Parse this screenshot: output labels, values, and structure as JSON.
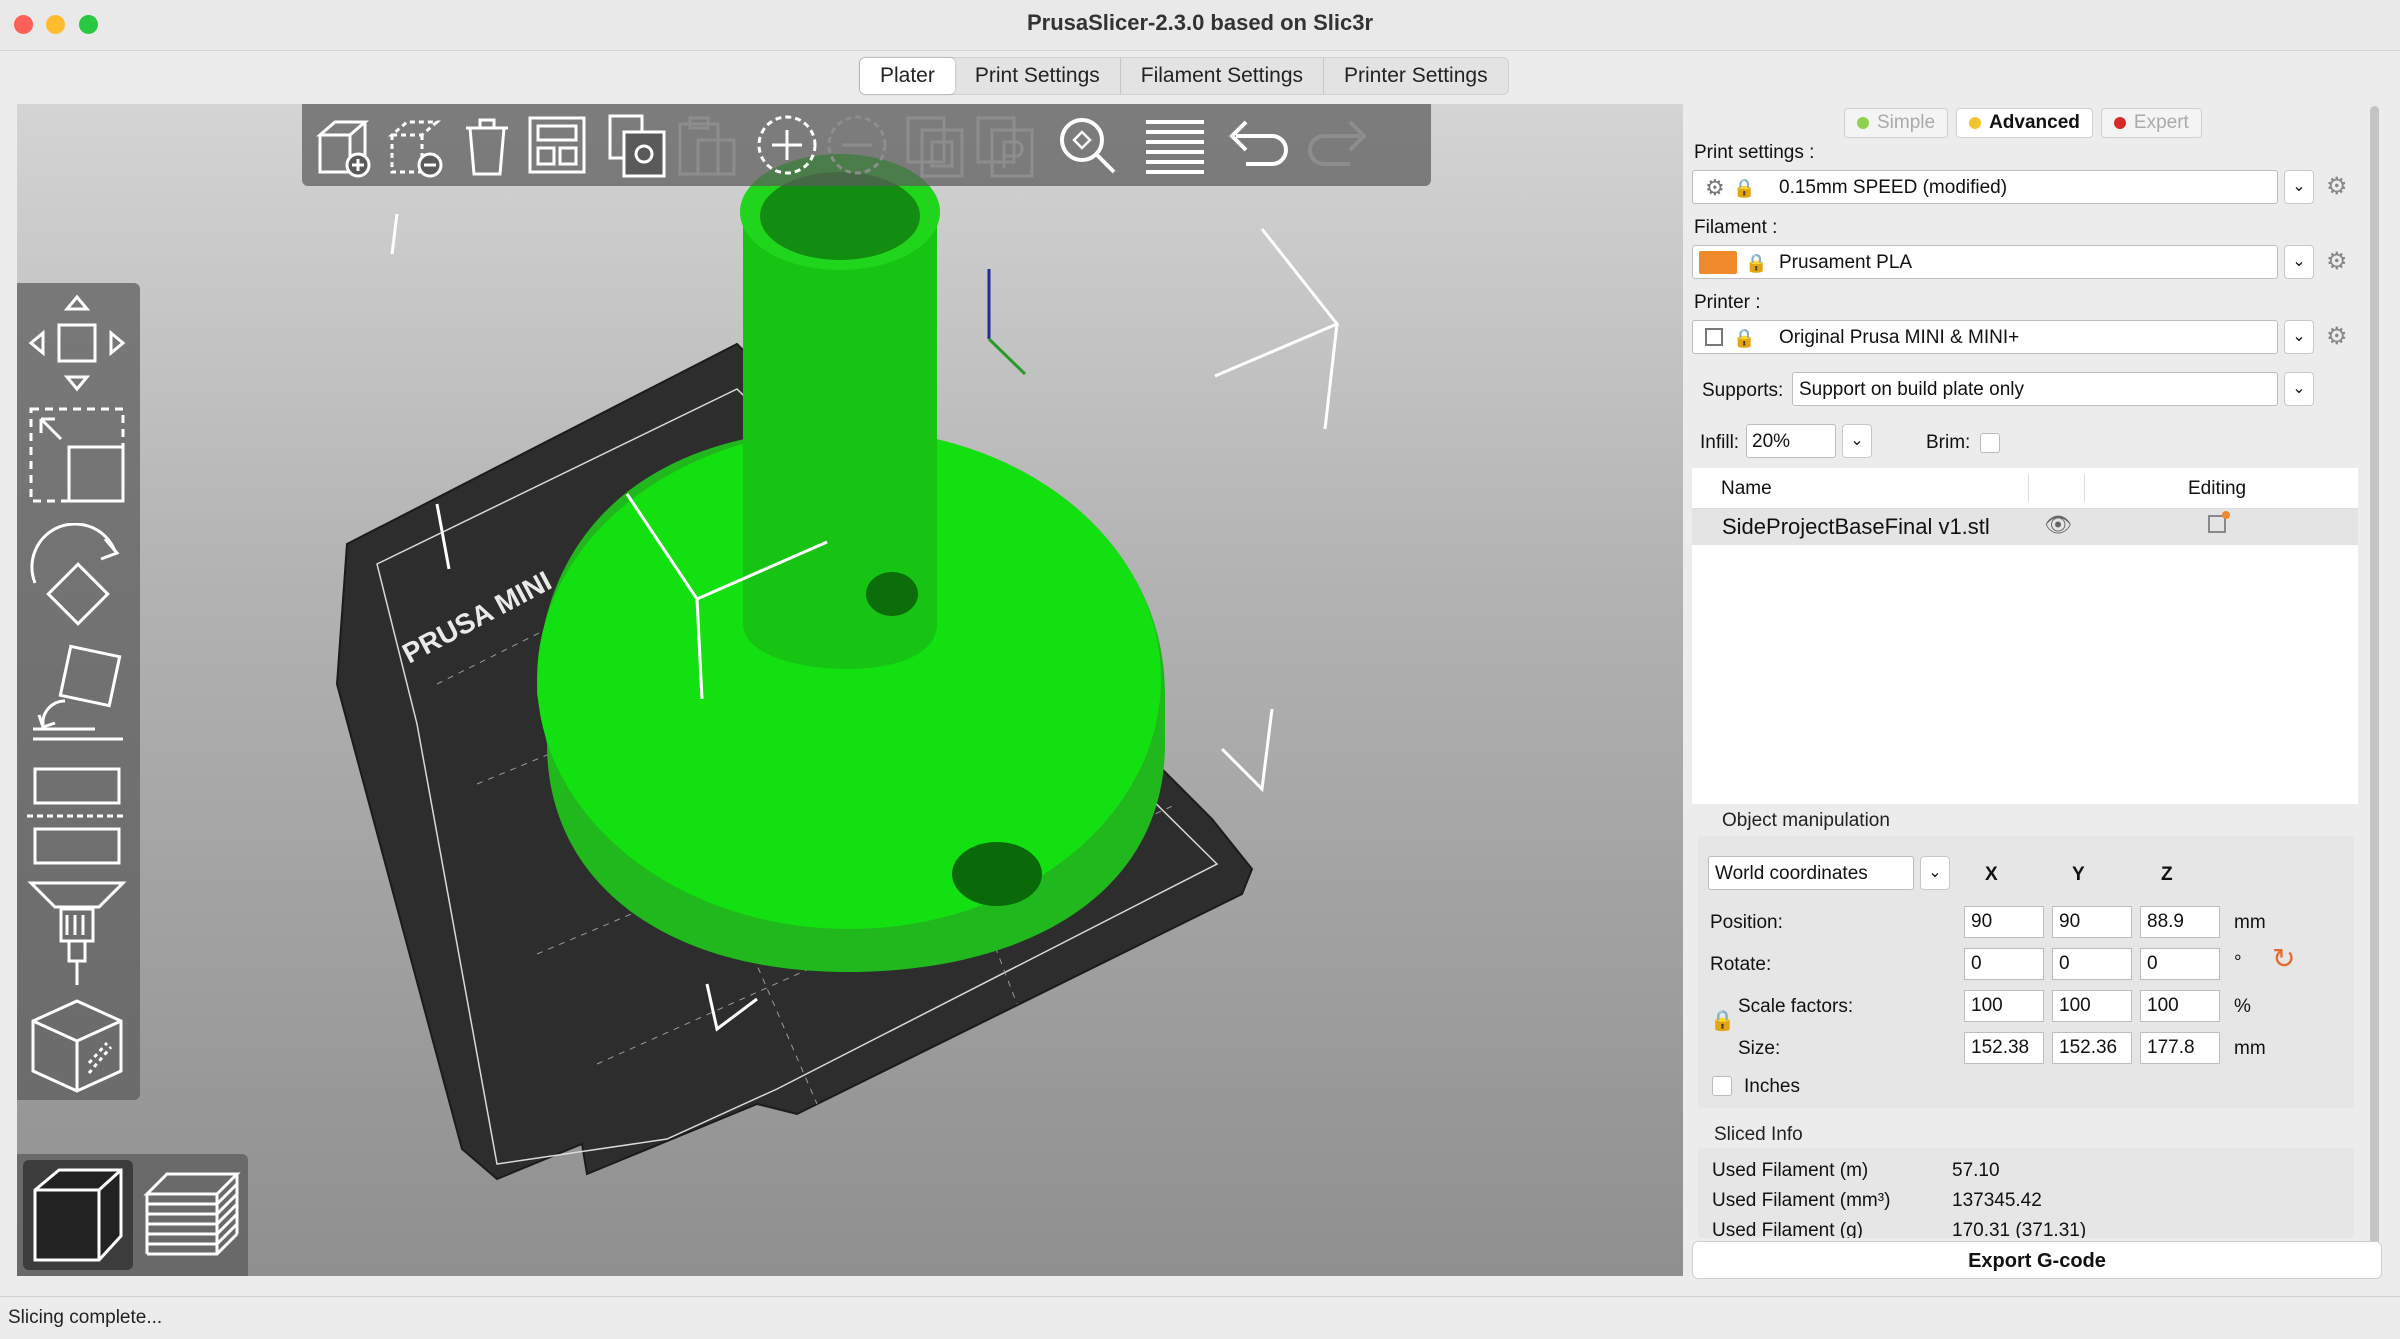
{
  "window": {
    "title": "PrusaSlicer-2.3.0 based on Slic3r"
  },
  "tabs": [
    {
      "label": "Plater"
    },
    {
      "label": "Print Settings"
    },
    {
      "label": "Filament Settings"
    },
    {
      "label": "Printer Settings"
    }
  ],
  "modes": {
    "simple": "Simple",
    "advanced": "Advanced",
    "expert": "Expert",
    "simple_color": "#8fd14f",
    "advanced_color": "#f4c430",
    "expert_color": "#d42a2a"
  },
  "print_settings": {
    "label": "Print settings :",
    "value": "0.15mm SPEED (modified)"
  },
  "filament": {
    "label": "Filament :",
    "value": "Prusament PLA",
    "color": "#f08a2a"
  },
  "printer": {
    "label": "Printer :",
    "value": "Original Prusa MINI & MINI+"
  },
  "supports": {
    "label": "Supports:",
    "value": "Support on build plate only"
  },
  "infill": {
    "label": "Infill:",
    "value": "20%"
  },
  "brim": {
    "label": "Brim:"
  },
  "object_list": {
    "col_name": "Name",
    "col_editing": "Editing",
    "items": [
      {
        "name": "SideProjectBaseFinal v1.stl"
      }
    ]
  },
  "manipulation": {
    "title": "Object manipulation",
    "coordinates": "World coordinates",
    "x": "X",
    "y": "Y",
    "z": "Z",
    "position": {
      "label": "Position:",
      "x": "90",
      "y": "90",
      "z": "88.9",
      "unit": "mm"
    },
    "rotate": {
      "label": "Rotate:",
      "x": "0",
      "y": "0",
      "z": "0",
      "unit": "°"
    },
    "scale": {
      "label": "Scale factors:",
      "x": "100",
      "y": "100",
      "z": "100",
      "unit": "%"
    },
    "size": {
      "label": "Size:",
      "x": "152.38",
      "y": "152.36",
      "z": "177.8",
      "unit": "mm"
    },
    "inches": "Inches"
  },
  "sliced_info": {
    "title": "Sliced Info",
    "rows": [
      {
        "label": "Used Filament (m)",
        "value": "57.10"
      },
      {
        "label": "Used Filament (mm³)",
        "value": "137345.42"
      },
      {
        "label": "Used Filament (g)",
        "value": "170.31 (371.31)"
      }
    ]
  },
  "bed_label": "PRUSA MINI",
  "export_button": "Export G-code",
  "status": "Slicing complete..."
}
